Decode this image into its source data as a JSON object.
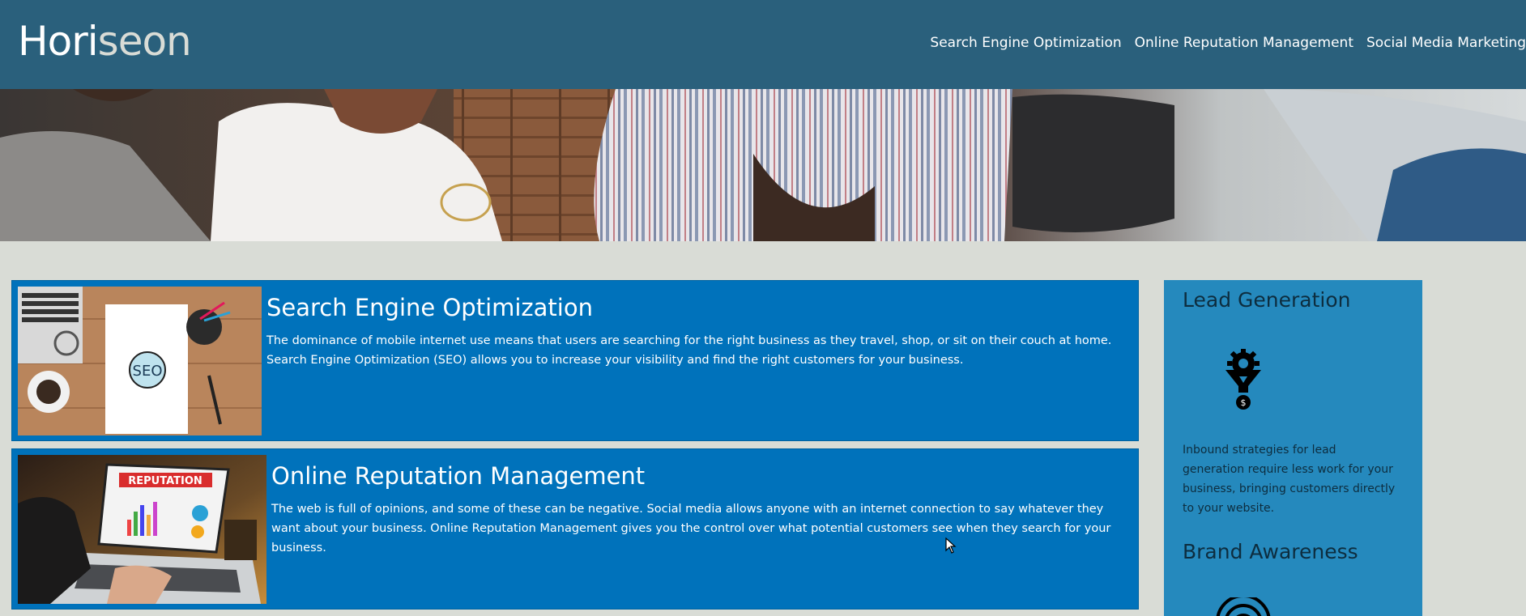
{
  "header": {
    "logo_part1": "Hori",
    "logo_part2": "seon",
    "nav": [
      {
        "label": "Search Engine Optimization"
      },
      {
        "label": "Online Reputation Management"
      },
      {
        "label": "Social Media Marketing"
      }
    ]
  },
  "content": {
    "cards": [
      {
        "title": "Search Engine Optimization",
        "text": "The dominance of mobile internet use means that users are searching for the right business as they travel, shop, or sit on their couch at home. Search Engine Optimization (SEO) allows you to increase your visibility and find the right customers for your business.",
        "image_badge": "SEO"
      },
      {
        "title": "Online Reputation Management",
        "text": "The web is full of opinions, and some of these can be negative. Social media allows anyone with an internet connection to say whatever they want about your business. Online Reputation Management gives you the control over what potential customers see when they search for your business.",
        "image_badge": "REPUTATION"
      }
    ]
  },
  "aside": {
    "items": [
      {
        "title": "Lead Generation",
        "text": "Inbound strategies for lead generation require less work for your business, bringing customers directly to your website.",
        "icon": "lead-generation-icon"
      },
      {
        "title": "Brand Awareness",
        "icon": "brand-awareness-icon"
      }
    ]
  },
  "colors": {
    "header_bg": "#2a607c",
    "page_bg": "#d9dcd6",
    "card_bg": "#0072bb",
    "aside_bg": "#2589bd"
  }
}
